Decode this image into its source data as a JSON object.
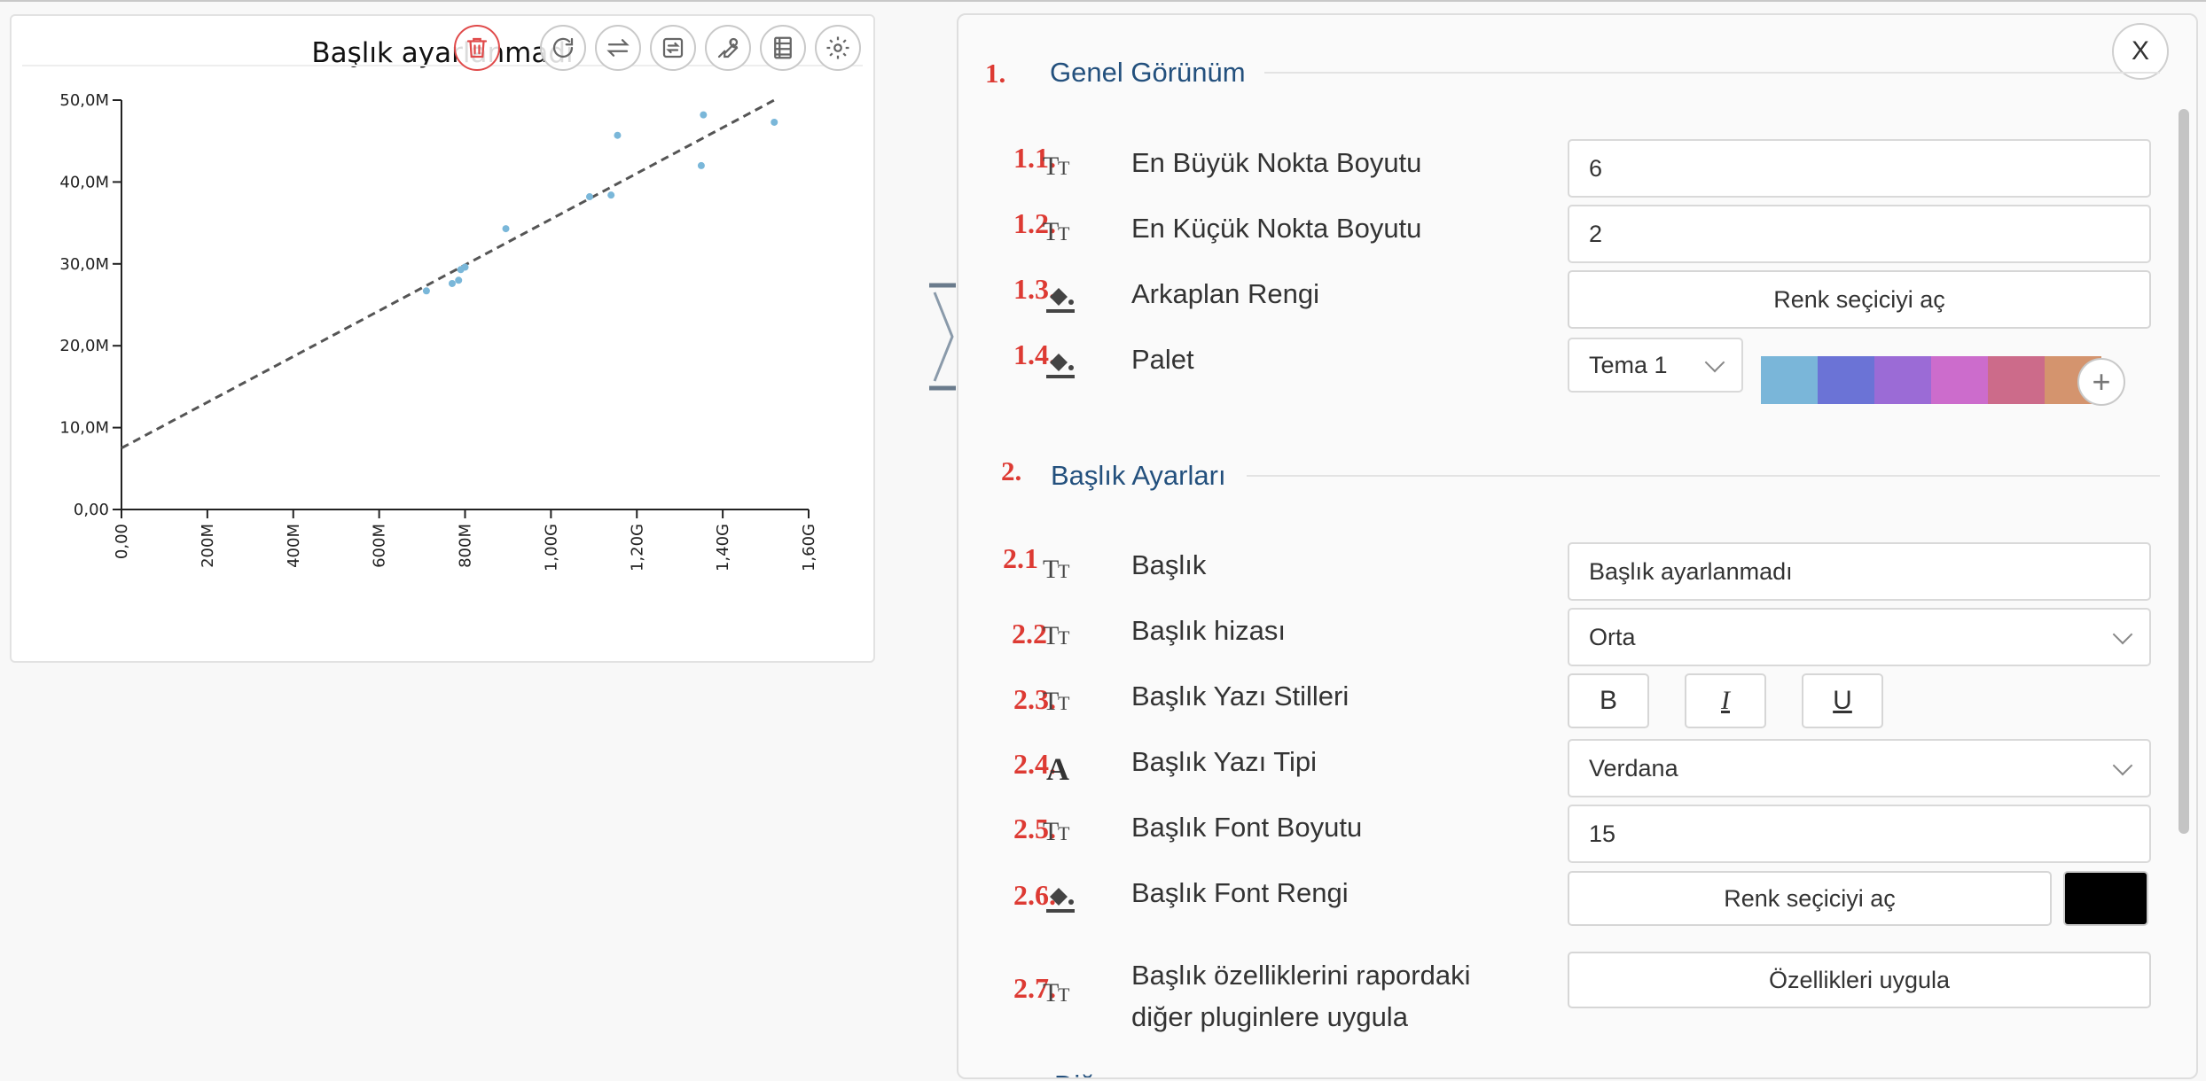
{
  "chart": {
    "title": "Başlık ayarlanmadı",
    "toolbar": [
      "delete",
      "refresh",
      "swap",
      "transfer",
      "tools",
      "table",
      "settings"
    ]
  },
  "chart_data": {
    "type": "scatter",
    "title": "Başlık ayarlanmadı",
    "xlabel": "",
    "ylabel": "",
    "xlim": [
      0,
      1600000000
    ],
    "ylim": [
      0,
      50000000
    ],
    "x_ticks": [
      "0,00",
      "200M",
      "400M",
      "600M",
      "800M",
      "1,00G",
      "1,20G",
      "1,40G",
      "1,60G"
    ],
    "y_ticks": [
      "0,00",
      "10,0M",
      "20,0M",
      "30,0M",
      "40,0M",
      "50,0M"
    ],
    "points": [
      {
        "x": 710000000,
        "y": 26700000
      },
      {
        "x": 770000000,
        "y": 27600000
      },
      {
        "x": 785000000,
        "y": 28000000
      },
      {
        "x": 790000000,
        "y": 29300000
      },
      {
        "x": 800000000,
        "y": 29600000
      },
      {
        "x": 895000000,
        "y": 34300000
      },
      {
        "x": 1090000000,
        "y": 38200000
      },
      {
        "x": 1140000000,
        "y": 38400000
      },
      {
        "x": 1155000000,
        "y": 45700000
      },
      {
        "x": 1350000000,
        "y": 42000000
      },
      {
        "x": 1355000000,
        "y": 48200000
      },
      {
        "x": 1520000000,
        "y": 47300000
      }
    ],
    "trendline": {
      "x": [
        0,
        1520000000
      ],
      "y": [
        7500000,
        50000000
      ],
      "style": "dashed"
    },
    "point_color": "#7ab7d9",
    "grid": false
  },
  "panel": {
    "close_label": "X",
    "sections": [
      {
        "num": "1.",
        "title": "Genel Görünüm"
      },
      {
        "num": "2.",
        "title": "Başlık Ayarları"
      }
    ],
    "general": {
      "max_point": {
        "num": "1.1.",
        "label": "En Büyük Nokta Boyutu",
        "value": "6"
      },
      "min_point": {
        "num": "1.2.",
        "label": "En Küçük Nokta Boyutu",
        "value": "2"
      },
      "bg_color": {
        "num": "1.3.",
        "label": "Arkaplan Rengi",
        "button": "Renk seçiciyi aç"
      },
      "palette": {
        "num": "1.4.",
        "label": "Palet",
        "selected": "Tema 1",
        "colors": [
          "#7ab6d9",
          "#6b73d6",
          "#9b6bd6",
          "#cc6ccc",
          "#cc6b8a",
          "#d4946e"
        ]
      }
    },
    "title_settings": {
      "title": {
        "num": "2.1",
        "label": "Başlık",
        "value": "Başlık ayarlanmadı"
      },
      "align": {
        "num": "2.2",
        "label": "Başlık hizası",
        "value": "Orta"
      },
      "styles": {
        "num": "2.3.",
        "label": "Başlık Yazı Stilleri",
        "bold": "B",
        "italic": "I",
        "underline": "U"
      },
      "font": {
        "num": "2.4.",
        "label": "Başlık Yazı Tipi",
        "value": "Verdana"
      },
      "font_size": {
        "num": "2.5.",
        "label": "Başlık Font Boyutu",
        "value": "15"
      },
      "font_color": {
        "num": "2.6.",
        "label": "Başlık Font Rengi",
        "button": "Renk seçiciyi aç",
        "color": "#000000"
      },
      "apply": {
        "num": "2.7.",
        "label_line1": "Başlık özelliklerini rapordaki",
        "label_line2": "diğer pluginlere uygula",
        "button": "Özellikleri uygula"
      }
    },
    "next_section_partial": "Diğ"
  },
  "colors": {
    "accent_red": "#dd3a33",
    "section_blue": "#23507d"
  }
}
